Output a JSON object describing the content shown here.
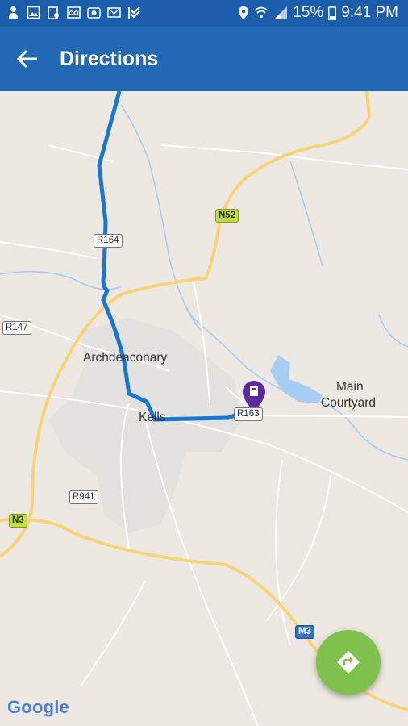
{
  "status_bar": {
    "battery": "15%",
    "time": "9:41 PM",
    "left_icons": [
      "person-icon",
      "image-icon",
      "clipboard-icon",
      "voicemail-icon",
      "camera-icon",
      "mail-icon",
      "check-flag-icon"
    ],
    "right_icons": [
      "location-icon",
      "wifi-icon",
      "signal-icon",
      "battery-icon"
    ]
  },
  "app_bar": {
    "title": "Directions",
    "back_icon": "arrow-back-icon",
    "color": "#2268b5"
  },
  "map": {
    "places": {
      "archdeaconary": "Archdeaconary",
      "kells": "Kells",
      "main_courtyard_1": "Main",
      "main_courtyard_2": "Courtyard"
    },
    "road_shields": {
      "r164": "R164",
      "r147": "R147",
      "n52": "N52",
      "r163": "R163",
      "r941": "R941",
      "n3": "N3",
      "m3": "M3"
    },
    "route_color": "#1976d2",
    "destination_marker": "location-pin-icon",
    "attribution": "Google"
  },
  "fab": {
    "icon": "directions-icon",
    "color": "#7fc14d"
  }
}
